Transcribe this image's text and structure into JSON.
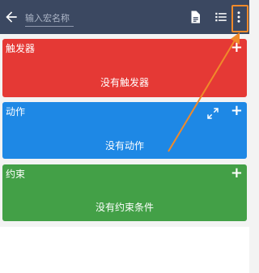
{
  "appbar": {
    "name_placeholder": "输入宏名称",
    "icons": [
      "back-arrow-icon",
      "document-icon",
      "list-icon",
      "more-vert-icon"
    ]
  },
  "sections": {
    "triggers": {
      "title": "触发器",
      "empty_text": "没有触发器",
      "add": "+",
      "color": "#e53935"
    },
    "actions": {
      "title": "动作",
      "empty_text": "没有动作",
      "add": "+",
      "color": "#1e88e5"
    },
    "constraints": {
      "title": "约束",
      "empty_text": "没有约束条件",
      "add": "+",
      "color": "#43a047"
    }
  },
  "annotation_color": "#f08a2a"
}
